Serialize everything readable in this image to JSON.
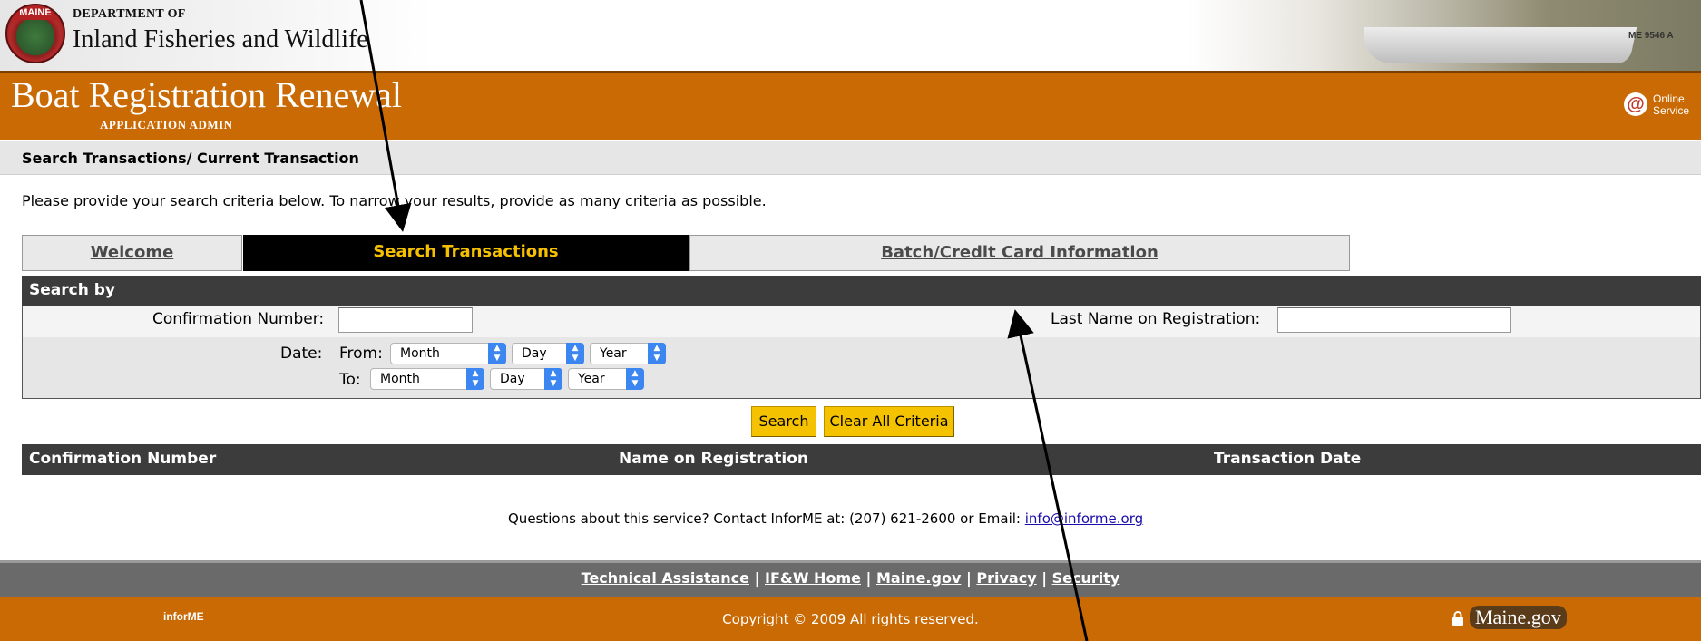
{
  "header": {
    "seal_label": "MAINE",
    "dept_line1": "DEPARTMENT OF",
    "dept_line2": "Inland Fisheries and Wildlife",
    "boat_registration_plate": "ME 9546 A",
    "app_title": "Boat Registration Renewal",
    "app_subtitle": "APPLICATION ADMIN",
    "online_service_icon": "@",
    "online_service_line1": "Online",
    "online_service_line2": "Service"
  },
  "section": {
    "title": "Search Transactions/ Current Transaction",
    "instructions": "Please provide your search criteria below. To narrow your results, provide as many criteria as possible."
  },
  "tabs": [
    {
      "label": "Welcome",
      "active": false
    },
    {
      "label": "Search Transactions",
      "active": true
    },
    {
      "label": "Batch/Credit Card Information",
      "active": false
    }
  ],
  "search_form": {
    "heading": "Search by",
    "confirmation_label": "Confirmation Number:",
    "confirmation_value": "",
    "last_name_label": "Last Name on Registration:",
    "last_name_value": "",
    "date_label": "Date:",
    "from_label": "From:",
    "to_label": "To:",
    "from": {
      "month": "Month",
      "day": "Day",
      "year": "Year"
    },
    "to": {
      "month": "Month",
      "day": "Day",
      "year": "Year"
    },
    "search_button": "Search",
    "clear_button": "Clear All Criteria"
  },
  "results": {
    "columns": [
      "Confirmation Number",
      "Name on Registration",
      "Transaction Date"
    ],
    "rows": []
  },
  "contact": {
    "text": "Questions about this service? Contact InforME at: (207) 621-2600 or Email: ",
    "email": "info@informe.org"
  },
  "footer": {
    "links": [
      "Technical Assistance",
      "IF&W Home",
      "Maine.gov",
      "Privacy",
      "Security"
    ],
    "separator": "|",
    "informe_logo": "inforME",
    "copyright": "Copyright © 2009 All rights reserved.",
    "mainegov_logo": "Maine.gov"
  },
  "colors": {
    "orange": "#c96a04",
    "dark_bar": "#3c3c3c",
    "button_yellow": "#f5c200",
    "active_tab_text": "#f5c000"
  },
  "annotations": {
    "arrow_color": "#000000"
  }
}
